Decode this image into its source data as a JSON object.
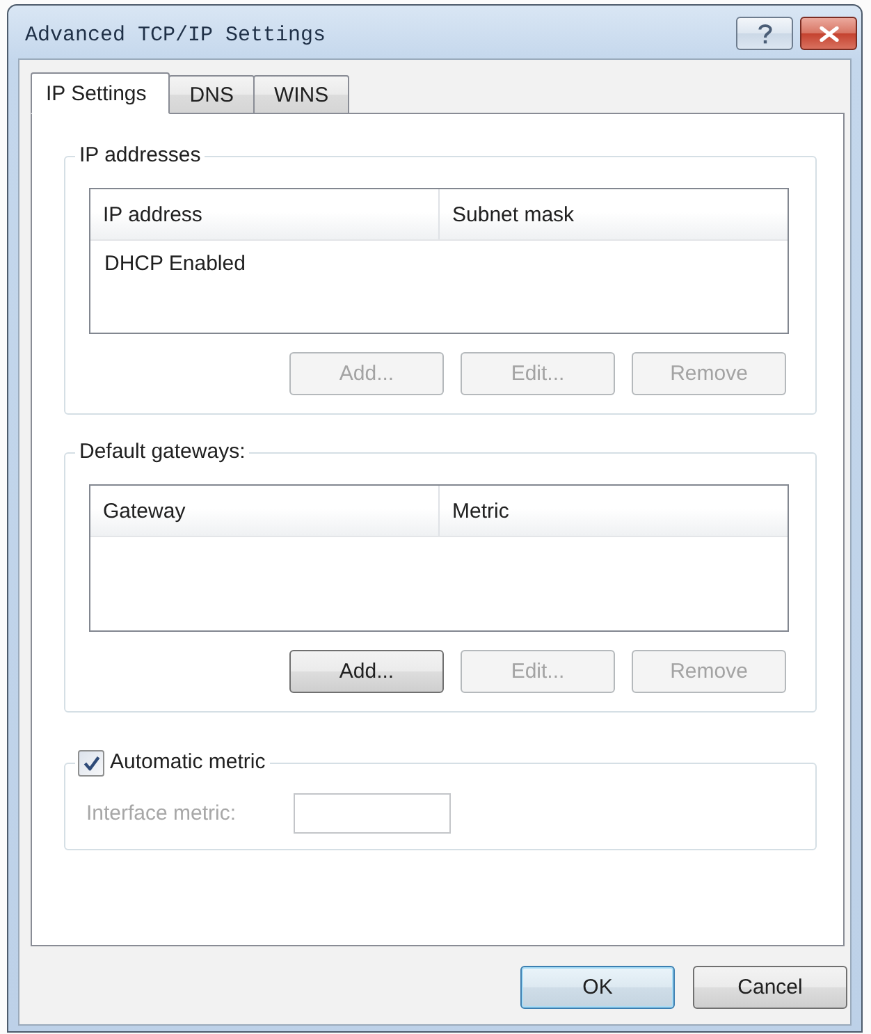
{
  "window": {
    "title": "Advanced TCP/IP Settings"
  },
  "tabs": [
    {
      "label": "IP Settings",
      "selected": true
    },
    {
      "label": "DNS",
      "selected": false
    },
    {
      "label": "WINS",
      "selected": false
    }
  ],
  "ip_addresses": {
    "label": "IP addresses",
    "columns": [
      "IP address",
      "Subnet mask"
    ],
    "rows": [
      [
        "DHCP Enabled"
      ]
    ],
    "buttons": [
      {
        "label": "Add...",
        "disabled": true
      },
      {
        "label": "Edit...",
        "disabled": true
      },
      {
        "label": "Remove",
        "disabled": true
      }
    ]
  },
  "default_gateways": {
    "label": "Default gateways:",
    "columns": [
      "Gateway",
      "Metric"
    ],
    "buttons": [
      {
        "label": "Add...",
        "disabled": false
      },
      {
        "label": "Edit...",
        "disabled": true
      },
      {
        "label": "Remove",
        "disabled": true
      }
    ]
  },
  "automatic_metric": {
    "label": "Automatic metric",
    "checked": true,
    "interface_metric": {
      "label": "Interface metric:",
      "disabled": true
    }
  },
  "buttons": [
    {
      "label": "OK",
      "default": true
    },
    {
      "label": "Cancel",
      "default": false
    }
  ]
}
